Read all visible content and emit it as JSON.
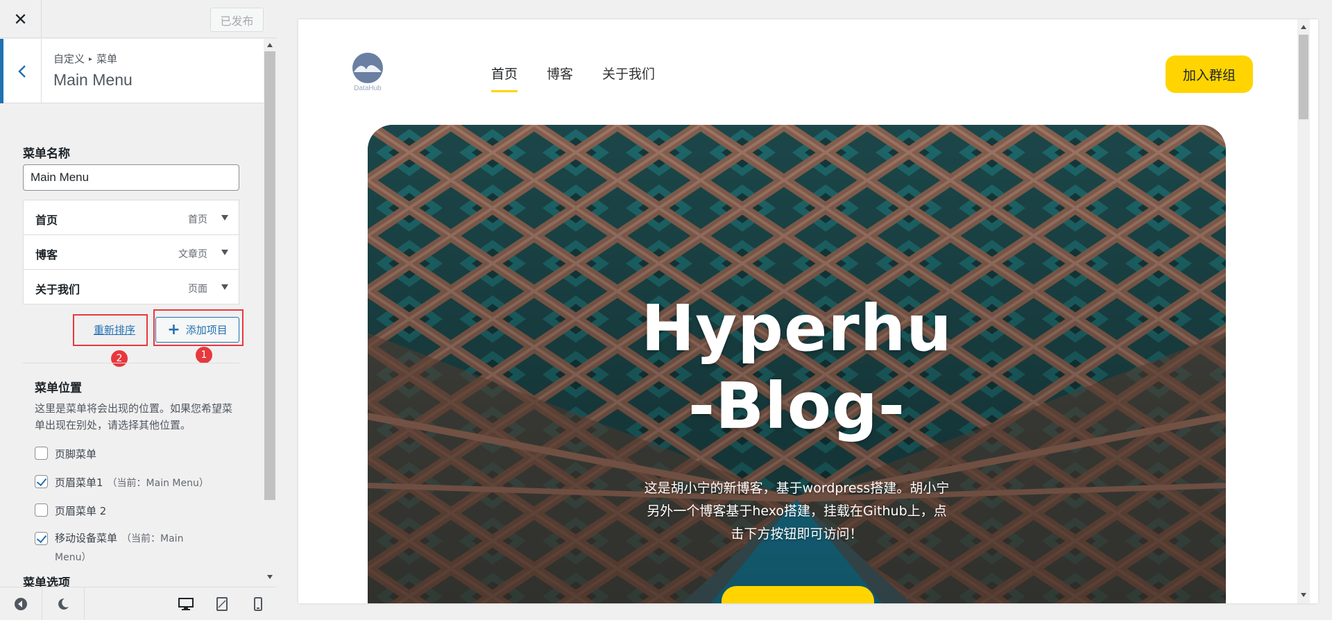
{
  "topbar": {
    "close_icon": "close-icon",
    "publish_label": "已发布"
  },
  "section": {
    "breadcrumb_root": "自定义",
    "breadcrumb_current": "菜单",
    "title": "Main Menu",
    "back_icon": "chevron-left-icon"
  },
  "menu_name": {
    "label": "菜单名称",
    "value": "Main Menu"
  },
  "menu_items": [
    {
      "title": "首页",
      "type": "首页"
    },
    {
      "title": "博客",
      "type": "文章页"
    },
    {
      "title": "关于我们",
      "type": "页面"
    }
  ],
  "actions": {
    "reorder_label": "重新排序",
    "add_label": "添加项目",
    "badge_1": "1",
    "badge_2": "2"
  },
  "locations": {
    "title": "菜单位置",
    "description": "这里是菜单将会出现的位置。如果您希望菜单出现在别处，请选择其他位置。",
    "items": [
      {
        "label": "页脚菜单",
        "note": "",
        "checked": false
      },
      {
        "label": "页眉菜单1",
        "note": "（当前：Main Menu）",
        "checked": true
      },
      {
        "label": "页眉菜单 2",
        "note": "",
        "checked": false
      },
      {
        "label": "移动设备菜单",
        "note": "（当前：Main Menu）",
        "checked": true
      }
    ]
  },
  "menu_options_title": "菜单选项",
  "preview": {
    "logo_text": "DataHub",
    "nav": [
      "首页",
      "博客",
      "关于我们"
    ],
    "join_label": "加入群组",
    "hero_title_line1": "Hyperhu",
    "hero_title_line2": "-Blog-",
    "hero_desc_line1": "这是胡小宁的新博客，基于wordpress搭建。胡小宁",
    "hero_desc_line2": "另外一个博客基于hexo搭建，挂载在Github上，点",
    "hero_desc_line3": "击下方按钮即可访问！"
  },
  "colors": {
    "accent": "#2271b1",
    "brand_yellow": "#ffd400",
    "annotation_red": "#e8383d"
  }
}
